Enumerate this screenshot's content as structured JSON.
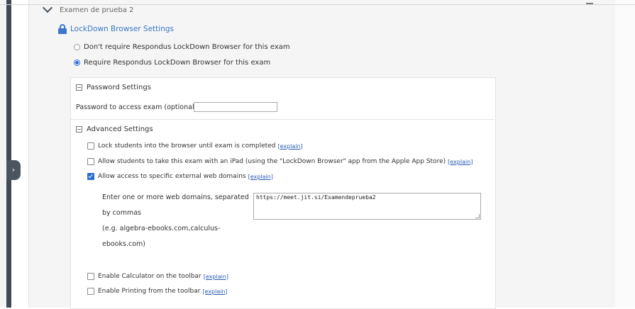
{
  "exam": {
    "title": "Examen de prueba 2"
  },
  "lockdown": {
    "title": "LockDown Browser Settings",
    "options": [
      {
        "label": "Don't require Respondus LockDown Browser for this exam",
        "selected": false
      },
      {
        "label": "Require Respondus LockDown Browser for this exam",
        "selected": true
      }
    ]
  },
  "password": {
    "section_title": "Password Settings",
    "label": "Password to access exam (optional)",
    "value": ""
  },
  "advanced": {
    "section_title": "Advanced Settings",
    "explain_text": "[explain]",
    "options": [
      {
        "label": "Lock students into the browser until exam is completed",
        "checked": false
      },
      {
        "label": "Allow students to take this exam with an iPad (using the \"LockDown Browser\" app from the Apple App Store)",
        "checked": false
      },
      {
        "label": "Allow access to specific external web domains",
        "checked": true
      },
      {
        "label": "Enable Calculator on the toolbar",
        "checked": false
      },
      {
        "label": "Enable Printing from the toolbar",
        "checked": false
      }
    ],
    "domains": {
      "help_lines": [
        "Enter one or more web domains, separated",
        "by commas",
        "(e.g. algebra-ebooks.com,calculus-",
        "ebooks.com)"
      ],
      "value": "https://meet.jit.si/Examendeprueba2"
    }
  },
  "icons": {
    "collapse": "chevron-down-icon",
    "lock": "lock-icon",
    "section_toggle": "minus-square-icon",
    "sidebar_toggle": "chevron-right-icon"
  },
  "colors": {
    "accent": "#3a78c7",
    "checkbox_checked": "#2a6ed4",
    "link": "#2a5db0",
    "sidebar": "#3f4a54"
  }
}
